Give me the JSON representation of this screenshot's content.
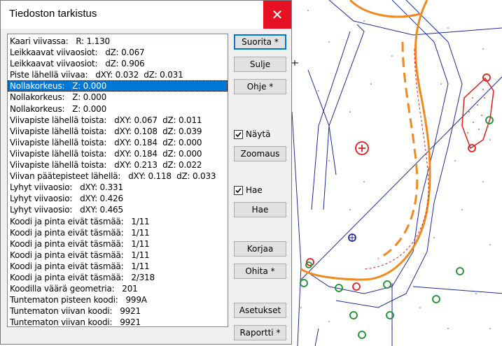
{
  "window": {
    "title": "Tiedoston tarkistus",
    "close_glyph": "✕"
  },
  "list": [
    "Kaari viivassa:   R: 1.130",
    "Leikkaavat viivaosiot:   dZ: 0.067",
    "Leikkaavat viivaosiot:   dZ: 0.906",
    "Piste lähellä viivaa:   dXY: 0.032  dZ: 0.031",
    "Nollakorkeus:   Z: 0.000",
    "Nollakorkeus:   Z: 0.000",
    "Nollakorkeus:   Z: 0.000",
    "Viivapiste lähellä toista:   dXY: 0.067  dZ: 0.011",
    "Viivapiste lähellä toista:   dXY: 0.108  dZ: 0.039",
    "Viivapiste lähellä toista:   dXY: 0.184  dZ: 0.000",
    "Viivapiste lähellä toista:   dXY: 0.184  dZ: 0.000",
    "Viivapiste lähellä toista:   dXY: 0.213  dZ: 0.022",
    "Viivan päätepisteet lähellä:   dXY: 0.118  dZ: 0.033",
    "Lyhyt viivaosio:   dXY: 0.331",
    "Lyhyt viivaosio:   dXY: 0.426",
    "Lyhyt viivaosio:   dXY: 0.465",
    "Koodi ja pinta eivät täsmää:   1/11",
    "Koodi ja pinta eivät täsmää:   1/11",
    "Koodi ja pinta eivät täsmää:   1/11",
    "Koodi ja pinta eivät täsmää:   1/11",
    "Koodi ja pinta eivät täsmää:   1/11",
    "Koodi ja pinta eivät täsmää:   2/318",
    "Koodilla väärä geometria:   201",
    "Tuntematon pisteen koodi:   999A",
    "Tuntematon viivan koodi:   9921",
    "Tuntematon viivan koodi:   9921"
  ],
  "selected_index": 4,
  "buttons": {
    "suorita": "Suorita *",
    "sulje": "Sulje",
    "ohje": "Ohje *",
    "zoomaus": "Zoomaus",
    "hae": "Hae",
    "korjaa": "Korjaa",
    "ohita": "Ohita *",
    "asetukset": "Asetukset",
    "raportti": "Raportti *"
  },
  "checkboxes": {
    "nayta": {
      "label": "Näytä",
      "checked": true
    },
    "hae": {
      "label": "Hae",
      "checked": true
    }
  },
  "colors": {
    "accent": "#0078d7",
    "close": "#e81123",
    "road": "#f0891e",
    "line": "#1e2a9b",
    "red": "#e01e1e",
    "green": "#1a8f2c"
  }
}
